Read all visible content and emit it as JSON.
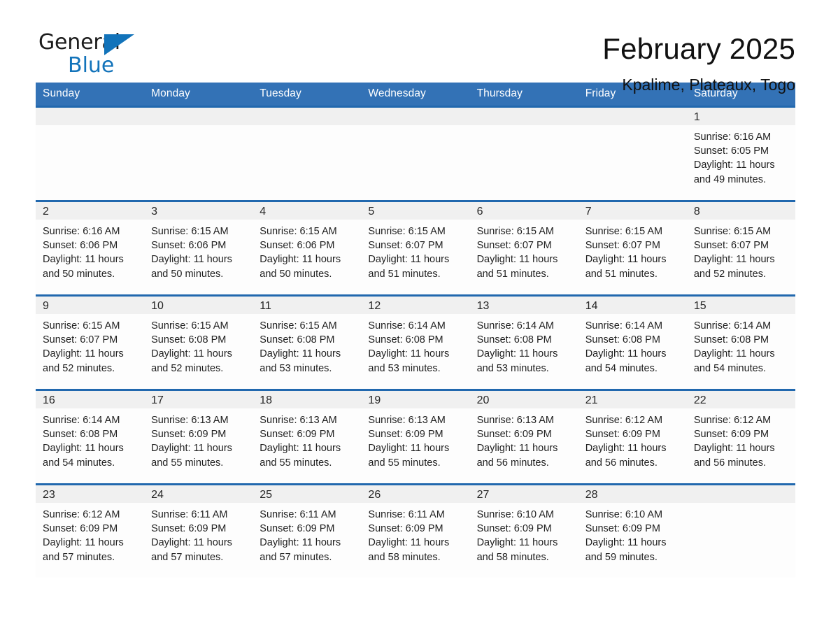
{
  "brand": {
    "name_part1": "General",
    "name_part2": "Blue",
    "accent_color": "#1273BA"
  },
  "header": {
    "title": "February 2025",
    "subtitle": "Kpalime, Plateaux, Togo"
  },
  "theme": {
    "header_blue": "#3372B6",
    "row_divider_blue": "#2168AE",
    "daynum_band_gray": "#F0F0F0"
  },
  "calendar": {
    "day_headers": [
      "Sunday",
      "Monday",
      "Tuesday",
      "Wednesday",
      "Thursday",
      "Friday",
      "Saturday"
    ],
    "weeks": [
      [
        {
          "day": "",
          "sunrise": "",
          "sunset": "",
          "daylight": ""
        },
        {
          "day": "",
          "sunrise": "",
          "sunset": "",
          "daylight": ""
        },
        {
          "day": "",
          "sunrise": "",
          "sunset": "",
          "daylight": ""
        },
        {
          "day": "",
          "sunrise": "",
          "sunset": "",
          "daylight": ""
        },
        {
          "day": "",
          "sunrise": "",
          "sunset": "",
          "daylight": ""
        },
        {
          "day": "",
          "sunrise": "",
          "sunset": "",
          "daylight": ""
        },
        {
          "day": "1",
          "sunrise": "Sunrise: 6:16 AM",
          "sunset": "Sunset: 6:05 PM",
          "daylight": "Daylight: 11 hours and 49 minutes."
        }
      ],
      [
        {
          "day": "2",
          "sunrise": "Sunrise: 6:16 AM",
          "sunset": "Sunset: 6:06 PM",
          "daylight": "Daylight: 11 hours and 50 minutes."
        },
        {
          "day": "3",
          "sunrise": "Sunrise: 6:15 AM",
          "sunset": "Sunset: 6:06 PM",
          "daylight": "Daylight: 11 hours and 50 minutes."
        },
        {
          "day": "4",
          "sunrise": "Sunrise: 6:15 AM",
          "sunset": "Sunset: 6:06 PM",
          "daylight": "Daylight: 11 hours and 50 minutes."
        },
        {
          "day": "5",
          "sunrise": "Sunrise: 6:15 AM",
          "sunset": "Sunset: 6:07 PM",
          "daylight": "Daylight: 11 hours and 51 minutes."
        },
        {
          "day": "6",
          "sunrise": "Sunrise: 6:15 AM",
          "sunset": "Sunset: 6:07 PM",
          "daylight": "Daylight: 11 hours and 51 minutes."
        },
        {
          "day": "7",
          "sunrise": "Sunrise: 6:15 AM",
          "sunset": "Sunset: 6:07 PM",
          "daylight": "Daylight: 11 hours and 51 minutes."
        },
        {
          "day": "8",
          "sunrise": "Sunrise: 6:15 AM",
          "sunset": "Sunset: 6:07 PM",
          "daylight": "Daylight: 11 hours and 52 minutes."
        }
      ],
      [
        {
          "day": "9",
          "sunrise": "Sunrise: 6:15 AM",
          "sunset": "Sunset: 6:07 PM",
          "daylight": "Daylight: 11 hours and 52 minutes."
        },
        {
          "day": "10",
          "sunrise": "Sunrise: 6:15 AM",
          "sunset": "Sunset: 6:08 PM",
          "daylight": "Daylight: 11 hours and 52 minutes."
        },
        {
          "day": "11",
          "sunrise": "Sunrise: 6:15 AM",
          "sunset": "Sunset: 6:08 PM",
          "daylight": "Daylight: 11 hours and 53 minutes."
        },
        {
          "day": "12",
          "sunrise": "Sunrise: 6:14 AM",
          "sunset": "Sunset: 6:08 PM",
          "daylight": "Daylight: 11 hours and 53 minutes."
        },
        {
          "day": "13",
          "sunrise": "Sunrise: 6:14 AM",
          "sunset": "Sunset: 6:08 PM",
          "daylight": "Daylight: 11 hours and 53 minutes."
        },
        {
          "day": "14",
          "sunrise": "Sunrise: 6:14 AM",
          "sunset": "Sunset: 6:08 PM",
          "daylight": "Daylight: 11 hours and 54 minutes."
        },
        {
          "day": "15",
          "sunrise": "Sunrise: 6:14 AM",
          "sunset": "Sunset: 6:08 PM",
          "daylight": "Daylight: 11 hours and 54 minutes."
        }
      ],
      [
        {
          "day": "16",
          "sunrise": "Sunrise: 6:14 AM",
          "sunset": "Sunset: 6:08 PM",
          "daylight": "Daylight: 11 hours and 54 minutes."
        },
        {
          "day": "17",
          "sunrise": "Sunrise: 6:13 AM",
          "sunset": "Sunset: 6:09 PM",
          "daylight": "Daylight: 11 hours and 55 minutes."
        },
        {
          "day": "18",
          "sunrise": "Sunrise: 6:13 AM",
          "sunset": "Sunset: 6:09 PM",
          "daylight": "Daylight: 11 hours and 55 minutes."
        },
        {
          "day": "19",
          "sunrise": "Sunrise: 6:13 AM",
          "sunset": "Sunset: 6:09 PM",
          "daylight": "Daylight: 11 hours and 55 minutes."
        },
        {
          "day": "20",
          "sunrise": "Sunrise: 6:13 AM",
          "sunset": "Sunset: 6:09 PM",
          "daylight": "Daylight: 11 hours and 56 minutes."
        },
        {
          "day": "21",
          "sunrise": "Sunrise: 6:12 AM",
          "sunset": "Sunset: 6:09 PM",
          "daylight": "Daylight: 11 hours and 56 minutes."
        },
        {
          "day": "22",
          "sunrise": "Sunrise: 6:12 AM",
          "sunset": "Sunset: 6:09 PM",
          "daylight": "Daylight: 11 hours and 56 minutes."
        }
      ],
      [
        {
          "day": "23",
          "sunrise": "Sunrise: 6:12 AM",
          "sunset": "Sunset: 6:09 PM",
          "daylight": "Daylight: 11 hours and 57 minutes."
        },
        {
          "day": "24",
          "sunrise": "Sunrise: 6:11 AM",
          "sunset": "Sunset: 6:09 PM",
          "daylight": "Daylight: 11 hours and 57 minutes."
        },
        {
          "day": "25",
          "sunrise": "Sunrise: 6:11 AM",
          "sunset": "Sunset: 6:09 PM",
          "daylight": "Daylight: 11 hours and 57 minutes."
        },
        {
          "day": "26",
          "sunrise": "Sunrise: 6:11 AM",
          "sunset": "Sunset: 6:09 PM",
          "daylight": "Daylight: 11 hours and 58 minutes."
        },
        {
          "day": "27",
          "sunrise": "Sunrise: 6:10 AM",
          "sunset": "Sunset: 6:09 PM",
          "daylight": "Daylight: 11 hours and 58 minutes."
        },
        {
          "day": "28",
          "sunrise": "Sunrise: 6:10 AM",
          "sunset": "Sunset: 6:09 PM",
          "daylight": "Daylight: 11 hours and 59 minutes."
        },
        {
          "day": "",
          "sunrise": "",
          "sunset": "",
          "daylight": ""
        }
      ]
    ]
  }
}
